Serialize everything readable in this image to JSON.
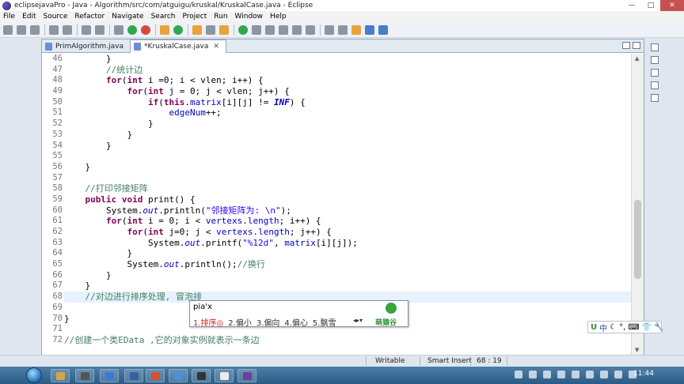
{
  "window": {
    "title": "eclipsejavaPro - Java - Algorithm/src/com/atguigu/kruskal/KruskalCase.java - Eclipse",
    "minimize": "—",
    "maximize": "□",
    "close": "✕"
  },
  "menu": [
    "File",
    "Edit",
    "Source",
    "Refactor",
    "Navigate",
    "Search",
    "Project",
    "Run",
    "Window",
    "Help"
  ],
  "tabs": [
    {
      "label": "PrimAlgorithm.java",
      "active": false
    },
    {
      "label": "*KruskalCase.java",
      "active": true,
      "close": "✕"
    }
  ],
  "editor": {
    "lines": [
      {
        "n": "46",
        "html": "        <span>}</span>"
      },
      {
        "n": "47",
        "html": "        <span class=\"cm\">//统计边</span>"
      },
      {
        "n": "48",
        "html": "        <span class=\"kw\">for</span>(<span class=\"kw\">int</span> i =0; i &lt; vlen; i++) {"
      },
      {
        "n": "49",
        "html": "            <span class=\"kw\">for</span>(<span class=\"kw\">int</span> j = 0; j &lt; vlen; j++) {"
      },
      {
        "n": "50",
        "html": "                <span class=\"kw\">if</span>(<span class=\"kw\">this</span>.<span class=\"fd\">matrix</span>[i][j] != <span class=\"sf\">INF</span>) {"
      },
      {
        "n": "51",
        "html": "                    <span class=\"fd\">edgeNum</span>++;"
      },
      {
        "n": "52",
        "html": "                }"
      },
      {
        "n": "53",
        "html": "            }"
      },
      {
        "n": "54",
        "html": "        }"
      },
      {
        "n": "55",
        "html": ""
      },
      {
        "n": "56",
        "html": "    }"
      },
      {
        "n": "57",
        "html": ""
      },
      {
        "n": "58",
        "html": "    <span class=\"cm\">//打印邻接矩阵</span>"
      },
      {
        "n": "59",
        "html": "    <span class=\"kw\">public</span> <span class=\"kw\">void</span> print() {"
      },
      {
        "n": "60",
        "html": "        System.<span class=\"fi\">out</span>.println(<span class=\"st\">\"邻接矩阵为: \\n\"</span>);"
      },
      {
        "n": "61",
        "html": "        <span class=\"kw\">for</span>(<span class=\"kw\">int</span> i = 0; i &lt; <span class=\"fd\">vertexs</span>.<span class=\"fd\">length</span>; i++) {"
      },
      {
        "n": "62",
        "html": "            <span class=\"kw\">for</span>(<span class=\"kw\">int</span> j=0; j &lt; <span class=\"fd\">vertexs</span>.<span class=\"fd\">length</span>; j++) {"
      },
      {
        "n": "63",
        "html": "                System.<span class=\"fi\">out</span>.printf(<span class=\"st\">\"%12d\"</span>, <span class=\"fd\">matrix</span>[i][j]);"
      },
      {
        "n": "64",
        "html": "            }"
      },
      {
        "n": "65",
        "html": "            System.<span class=\"fi\">out</span>.println();<span class=\"cm\">//换行</span>"
      },
      {
        "n": "66",
        "html": "        }"
      },
      {
        "n": "67",
        "html": "    }"
      },
      {
        "n": "68",
        "html": "    <span class=\"cm\">//对边进行排序处理, 冒泡排</span>",
        "current": true
      },
      {
        "n": "69",
        "html": ""
      },
      {
        "n": "70",
        "html": "}"
      },
      {
        "n": "71",
        "html": ""
      },
      {
        "n": "72",
        "html": "<span class=\"cm\">//创建一个类EData ,它的对象实例就表示一条边</span>"
      }
    ]
  },
  "ime_popup": {
    "composition": "pia'x",
    "candidates": [
      "1.排序◎",
      "2.偏小",
      "3.偏向",
      "4.偏心",
      "5.飘雪"
    ],
    "pager": "◂▸▾",
    "brand": "萌猿谷"
  },
  "ime_toolbar": {
    "items": [
      "U",
      "中",
      "☾",
      "°,",
      "⌨",
      "👕",
      "🔧"
    ]
  },
  "status": {
    "writable": "Writable",
    "insert_mode": "Smart Insert",
    "position": "68 : 19"
  },
  "taskbar": {
    "clock": "11:44"
  }
}
